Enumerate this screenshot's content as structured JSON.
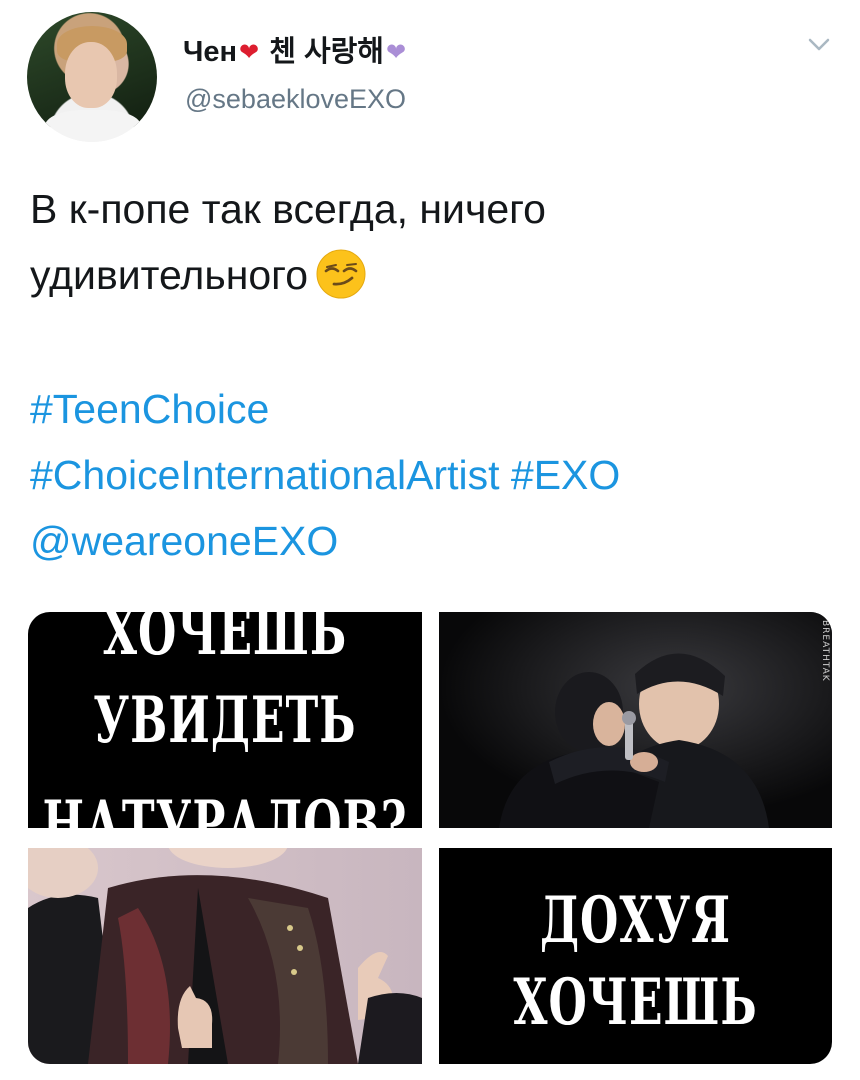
{
  "user": {
    "name_part1": "Чен",
    "name_part2": "첸 사랑해",
    "heart1_icon": "red-heart",
    "heart2_icon": "purple-heart",
    "handle": "@sebaekloveEXO"
  },
  "tweet": {
    "text_line1": "В к-попе так всегда, ничего",
    "text_line2": "удивительного",
    "emoji_icon": "smirking-face",
    "hashtags": {
      "h1": "#TeenChoice",
      "h2": "#ChoiceInternationalArtist",
      "h3": "#EXO",
      "mention": "@weareoneEXO"
    }
  },
  "media": {
    "image1": {
      "line1": "ХОЧЕШЬ",
      "line2": "УВИДЕТЬ",
      "line3": "НАТУРАЛОВ?"
    },
    "image2": {
      "watermark": "BREATHTAK"
    },
    "image4": {
      "line1": "ДОХУЯ",
      "line2": "ХОЧЕШЬ"
    }
  },
  "colors": {
    "link": "#1b95e0",
    "text": "#14171a",
    "secondary": "#657786"
  }
}
